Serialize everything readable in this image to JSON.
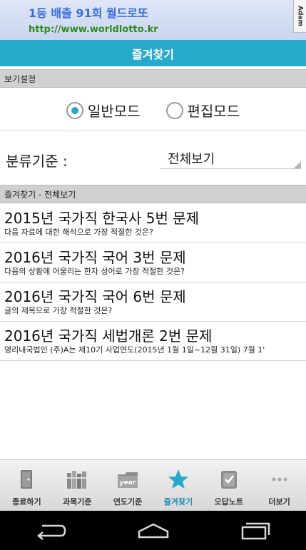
{
  "ad": {
    "title": "1등 배출 91회 월드로또",
    "url": "http://www.worldlotto.kr",
    "badge": "Adam"
  },
  "titlebar": {
    "title": "즐겨찾기"
  },
  "view_settings": {
    "header": "보기설정",
    "modes": [
      {
        "label": "일반모드",
        "selected": true
      },
      {
        "label": "편집모드",
        "selected": false
      }
    ]
  },
  "category": {
    "label": "분류기준 :",
    "value": "전체보기"
  },
  "list": {
    "header": "즐겨찾기 - 전체보기",
    "items": [
      {
        "title": "2015년 국가직 한국사 5번 문제",
        "desc": "다음 자료에 대한 해석으로 가장 적절한 것은?"
      },
      {
        "title": "2016년 국가직 국어 3번 문제",
        "desc": "다음의 상황에 어울리는 한자 성어로 가장 적절한 것은?"
      },
      {
        "title": "2016년 국가직 국어 6번 문제",
        "desc": "글의 제목으로 가장 적절한 것은?"
      },
      {
        "title": "2016년 국가직 세법개론 2번 문제",
        "desc": "영리내국법인 (주)A는 제10기 사업연도(2015년 1월 1일~12월 31일) 7월 1'"
      }
    ]
  },
  "tabs": [
    {
      "label": "종료하기",
      "icon": "exit-door-icon"
    },
    {
      "label": "과목기준",
      "icon": "books-icon"
    },
    {
      "label": "연도기준",
      "icon": "year-folder-icon",
      "icon_text": "year"
    },
    {
      "label": "즐겨찾기",
      "icon": "star-icon",
      "active": true
    },
    {
      "label": "오답노트",
      "icon": "notebook-check-icon"
    },
    {
      "label": "더보기",
      "icon": "more-dots-icon"
    }
  ],
  "colors": {
    "accent": "#27a9cc",
    "section_bg": "#d0d0d0",
    "ad_title": "#3a6fd8",
    "ad_url": "#2f8a1f"
  }
}
